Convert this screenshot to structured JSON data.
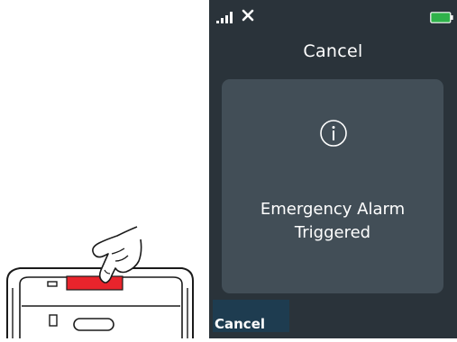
{
  "status_bar": {
    "signal_icon": "signal-bars-icon",
    "network_icon": "no-network-x-icon",
    "battery_icon": "battery-full-icon",
    "battery_color": "#2fb24a"
  },
  "screen": {
    "title": "Cancel",
    "background": "#2a333a"
  },
  "alert": {
    "icon": "info-circle-icon",
    "message": "Emergency Alarm\nTriggered",
    "card_color": "#424e57"
  },
  "softkey": {
    "label": "Cancel",
    "color": "#1e3c50"
  },
  "illustration": {
    "alarm_button_color": "#e8242c",
    "subject": "finger-pressing-alarm-button-icon"
  }
}
